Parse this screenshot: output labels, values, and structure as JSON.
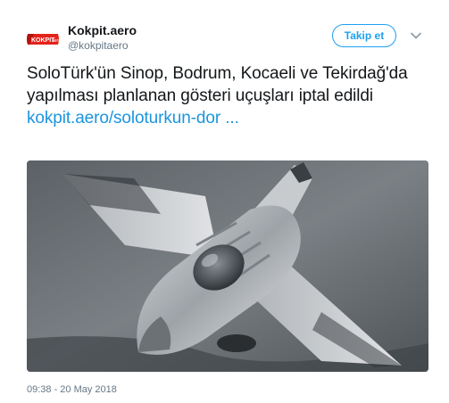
{
  "account": {
    "display_name": "Kokpit.aero",
    "handle": "@kokpitaero",
    "avatar_logo_text": "KOKPIT.aero"
  },
  "follow_button": {
    "label": "Takip et"
  },
  "tweet": {
    "text": "SoloTürk'ün Sinop, Bodrum, Kocaeli ve Tekirdağ'da yapılması planlanan gösteri uçuşları iptal edildi",
    "link": "kokpit.aero/soloturkun-dor ...",
    "timestamp": "09:38 - 20 May 2018"
  },
  "media": {
    "description_icon": "fighter-jet-photo"
  },
  "colors": {
    "accent": "#1da1f2",
    "link": "#1b95e0",
    "secondary_text": "#657786",
    "logo_red": "#e2231a"
  }
}
